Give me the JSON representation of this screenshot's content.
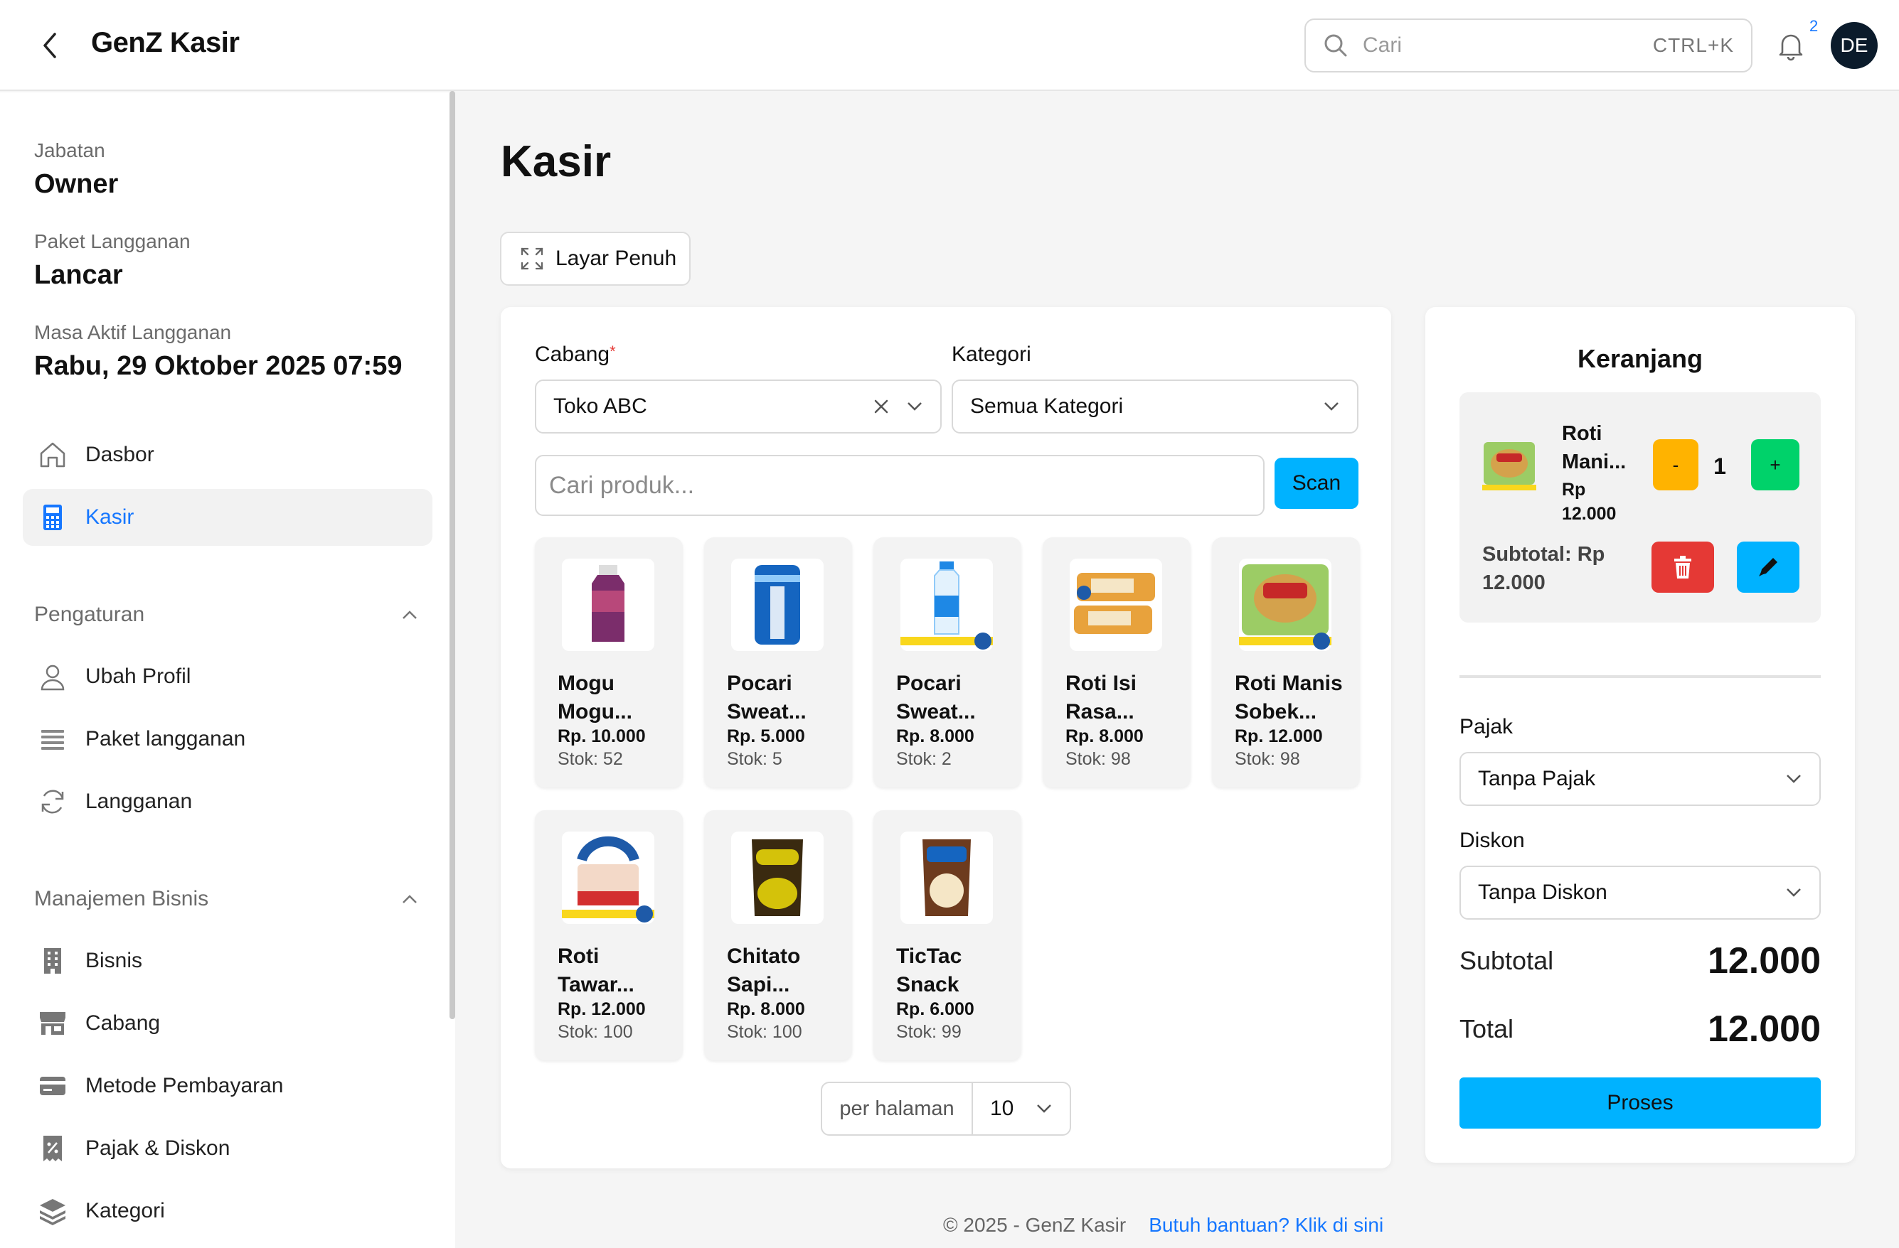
{
  "header": {
    "title": "GenZ Kasir",
    "search_placeholder": "Cari",
    "search_shortcut": "CTRL+K",
    "notification_count": "2",
    "avatar_initials": "DE"
  },
  "sidebar": {
    "info": [
      {
        "label": "Jabatan",
        "value": "Owner"
      },
      {
        "label": "Paket Langganan",
        "value": "Lancar"
      },
      {
        "label": "Masa Aktif Langganan",
        "value": "Rabu, 29 Oktober 2025 07:59"
      }
    ],
    "main_items": [
      {
        "label": "Dasbor",
        "icon": "home-icon"
      },
      {
        "label": "Kasir",
        "icon": "calculator-icon",
        "active": true
      }
    ],
    "section_settings": {
      "title": "Pengaturan",
      "items": [
        {
          "label": "Ubah Profil",
          "icon": "user-icon"
        },
        {
          "label": "Paket langganan",
          "icon": "list-icon"
        },
        {
          "label": "Langganan",
          "icon": "refresh-icon"
        }
      ]
    },
    "section_business": {
      "title": "Manajemen Bisnis",
      "items": [
        {
          "label": "Bisnis",
          "icon": "building-icon"
        },
        {
          "label": "Cabang",
          "icon": "store-icon"
        },
        {
          "label": "Metode Pembayaran",
          "icon": "card-icon"
        },
        {
          "label": "Pajak & Diskon",
          "icon": "receipt-icon"
        },
        {
          "label": "Kategori",
          "icon": "layers-icon"
        }
      ]
    }
  },
  "main": {
    "page_title": "Kasir",
    "fullscreen_label": "Layar Penuh",
    "branch_label": "Cabang",
    "branch_value": "Toko ABC",
    "category_label": "Kategori",
    "category_value": "Semua Kategori",
    "product_search_placeholder": "Cari produk...",
    "scan_label": "Scan",
    "products": [
      {
        "name": "Mogu Mogu...",
        "price": "Rp. 10.000",
        "stock": "Stok: 52",
        "color": "#7b2d6b"
      },
      {
        "name": "Pocari Sweat...",
        "price": "Rp. 5.000",
        "stock": "Stok: 5",
        "color": "#1565c0"
      },
      {
        "name": "Pocari Sweat...",
        "price": "Rp. 8.000",
        "stock": "Stok: 2",
        "color": "#1e88e5"
      },
      {
        "name": "Roti Isi Rasa...",
        "price": "Rp. 8.000",
        "stock": "Stok: 98",
        "color": "#e8a23c"
      },
      {
        "name": "Roti Manis Sobek...",
        "price": "Rp. 12.000",
        "stock": "Stok: 98",
        "color": "#9ccc65"
      },
      {
        "name": "Roti Tawar...",
        "price": "Rp. 12.000",
        "stock": "Stok: 100",
        "color": "#1e5aa8"
      },
      {
        "name": "Chitato Sapi...",
        "price": "Rp. 8.000",
        "stock": "Stok: 100",
        "color": "#d4c20a"
      },
      {
        "name": "TicTac Snack",
        "price": "Rp. 6.000",
        "stock": "Stok: 99",
        "color": "#6d3b1e"
      }
    ],
    "per_page_label": "per halaman",
    "per_page_value": "10"
  },
  "cart": {
    "title": "Keranjang",
    "item": {
      "name": "Roti Mani...",
      "price": "Rp 12.000",
      "qty": "1",
      "minus": "-",
      "plus": "+",
      "subtotal": "Subtotal: Rp 12.000"
    },
    "tax_label": "Pajak",
    "tax_value": "Tanpa Pajak",
    "discount_label": "Diskon",
    "discount_value": "Tanpa Diskon",
    "subtotal_label": "Subtotal",
    "subtotal_value": "12.000",
    "total_label": "Total",
    "total_value": "12.000",
    "process_label": "Proses"
  },
  "footer": {
    "copyright": "© 2025 - GenZ Kasir",
    "help_link": "Butuh bantuan? Klik di sini"
  },
  "colors": {
    "accent": "#1677ff",
    "scan": "#00b2ff",
    "minus": "#ffb300",
    "plus": "#00d26a",
    "delete": "#e53935"
  }
}
